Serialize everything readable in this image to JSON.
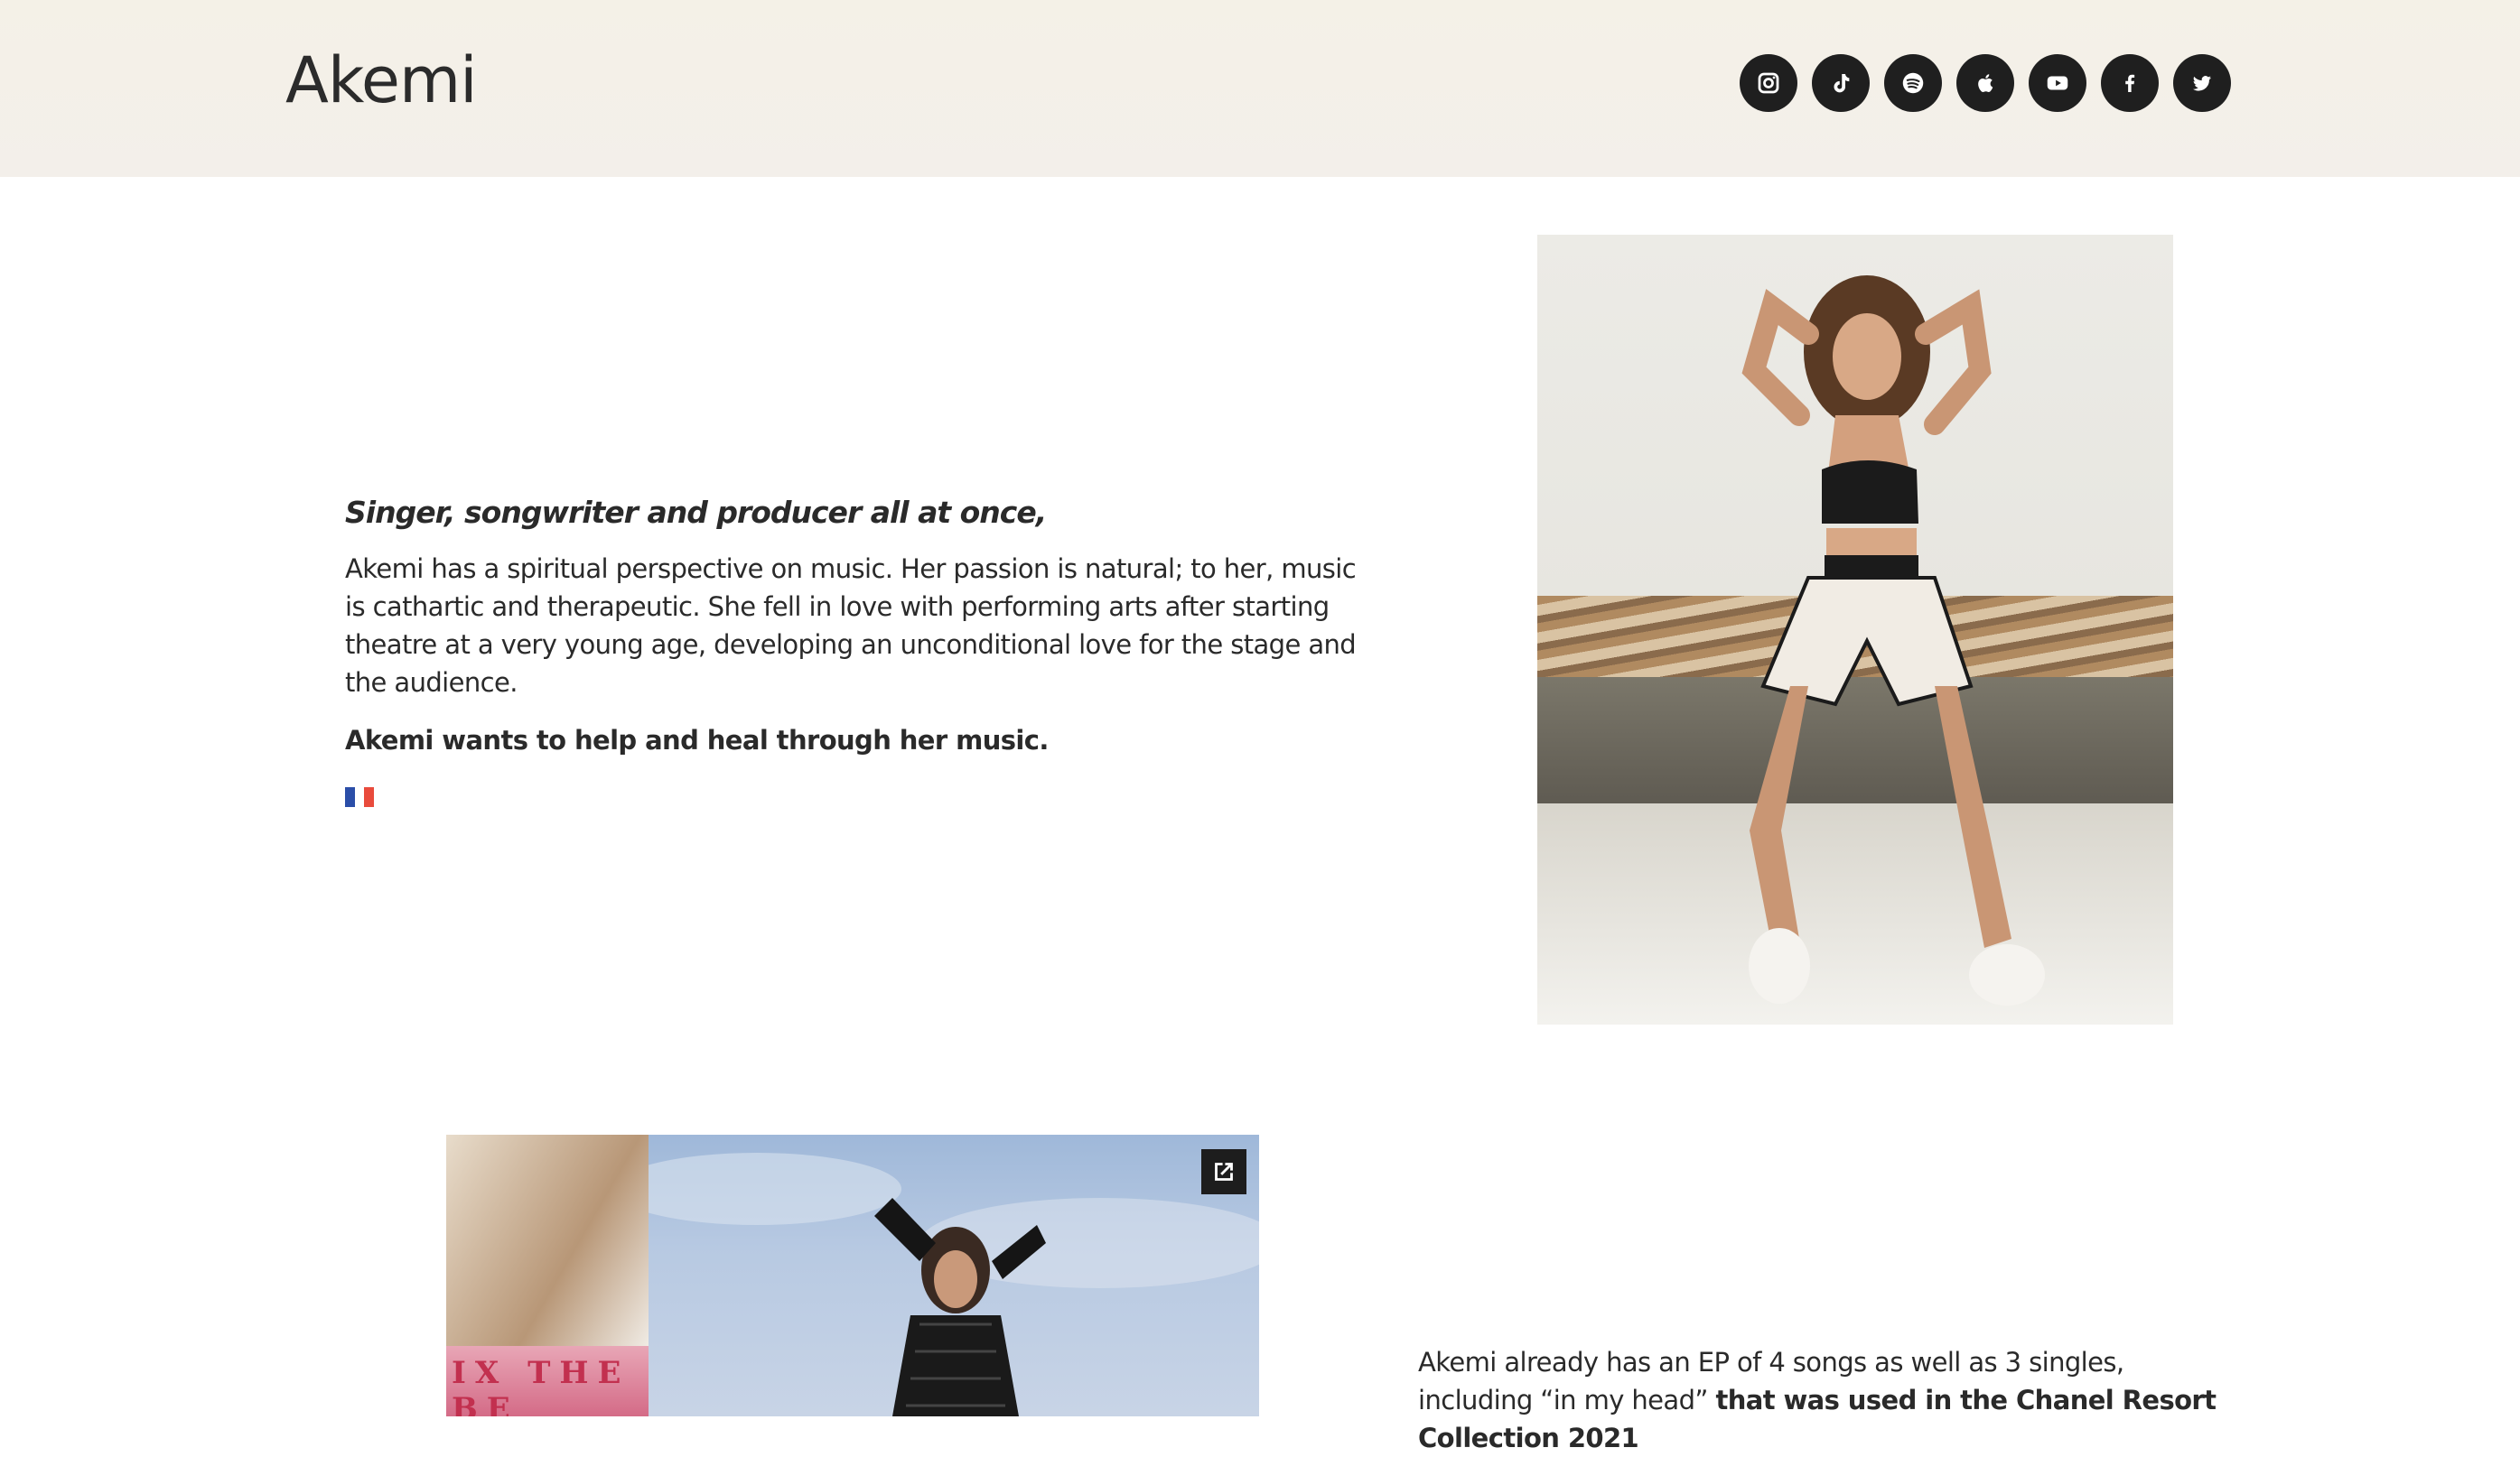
{
  "header": {
    "brand": "Akemi",
    "social_icons": [
      "instagram-icon",
      "tiktok-icon",
      "spotify-icon",
      "apple-music-icon",
      "youtube-icon",
      "facebook-icon",
      "twitter-icon"
    ]
  },
  "intro": {
    "tagline": "Singer, songwriter and producer all at once,",
    "bio": "Akemi has a spiritual perspective on music. Her passion is natural; to her, music is cathartic and therapeutic. She fell in love with performing arts after starting theatre at a very young age, developing an unconditional love for the stage and the audience.",
    "mission": "Akemi wants to help and heal through her music.",
    "flag_icon": "france-flag-icon"
  },
  "collage": {
    "thumb_text": "IX THE BE",
    "open_icon": "external-link-icon"
  },
  "ep": {
    "text_part1": "Akemi already has an EP of 4 songs as well as 3 singles, including “in my head” ",
    "text_bold": "that was used in the Chanel Resort Collection 2021"
  },
  "colors": {
    "header_bg": "#f3efea",
    "icon_bg": "#1f1f1f",
    "text": "#2a2a2a",
    "flag_blue": "#2b4ea8",
    "flag_red": "#e94b3c"
  }
}
